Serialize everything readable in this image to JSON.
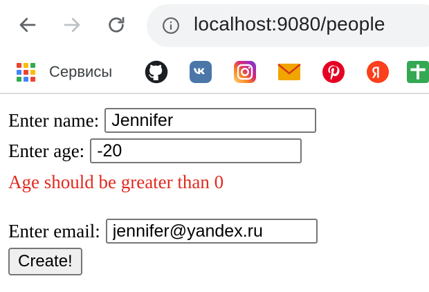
{
  "browser": {
    "url": "localhost:9080/people",
    "icons": [
      "back-arrow-icon",
      "forward-arrow-icon",
      "reload-icon",
      "info-icon"
    ]
  },
  "bookmarks": {
    "apps_label": "Сервисы",
    "apps_grid_colors": [
      "#ea4335",
      "#fbbc05",
      "#34a853",
      "#4285f4",
      "#ea4335",
      "#fbbc05",
      "#34a853",
      "#4285f4",
      "#ea4335"
    ],
    "items": [
      {
        "name": "github",
        "icon": "github-icon"
      },
      {
        "name": "vk",
        "icon": "vk-icon",
        "color": "#4a76a8"
      },
      {
        "name": "instagram",
        "icon": "instagram-icon"
      },
      {
        "name": "mail",
        "icon": "mail-envelope-icon",
        "color": "#f0a500"
      },
      {
        "name": "pinterest",
        "icon": "pinterest-icon",
        "color": "#e60023"
      },
      {
        "name": "yandex",
        "icon": "yandex-icon",
        "color": "#fc3f1d"
      },
      {
        "name": "plus",
        "icon": "green-plus-icon",
        "color": "#34a853"
      }
    ]
  },
  "form": {
    "name_label": "Enter name:",
    "name_value": "Jennifer",
    "age_label": "Enter age:",
    "age_value": "-20",
    "age_error": "Age should be greater than 0",
    "error_color": "#e22a1f",
    "email_label": "Enter email:",
    "email_value": "jennifer@yandex.ru",
    "submit_label": "Create!"
  }
}
